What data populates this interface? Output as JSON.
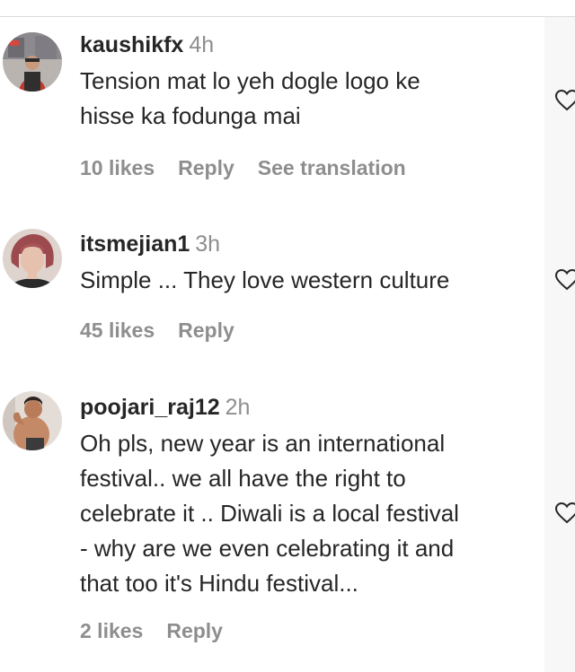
{
  "comments": [
    {
      "username": "kaushikfx",
      "time": "4h",
      "lines": [
        "Tension mat lo yeh dogle logo ke",
        "hisse ka fodunga mai"
      ],
      "likes": "10 likes",
      "reply": "Reply",
      "translate": "See translation"
    },
    {
      "username": "itsmejian1",
      "time": "3h",
      "lines": [
        "Simple ... They love western culture"
      ],
      "likes": "45 likes",
      "reply": "Reply"
    },
    {
      "username": "poojari_raj12",
      "time": "2h",
      "lines": [
        "Oh pls, new year is an international",
        "festival.. we all have the right to",
        "celebrate it .. Diwali is a local festival",
        "- why are we even celebrating it and",
        "that too it's Hindu festival..."
      ],
      "likes": "2 likes",
      "reply": "Reply"
    }
  ],
  "icons": {
    "like": "heart-outline-icon"
  },
  "colors": {
    "text": "#262626",
    "muted": "#8e8e8e",
    "divider": "#dbdbdb"
  }
}
